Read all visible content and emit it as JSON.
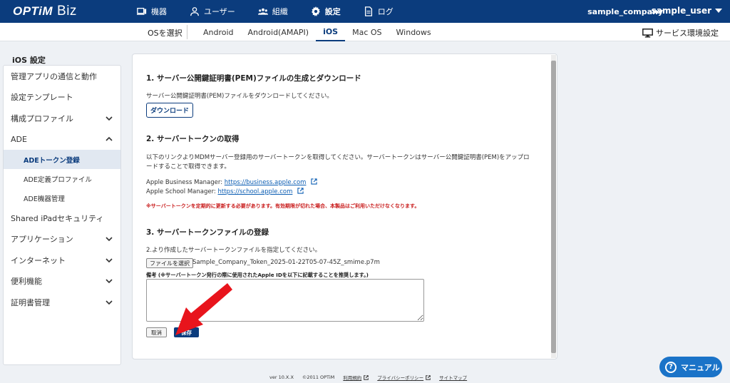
{
  "app": {
    "logo_main": "OPTiM",
    "logo_sub": "Biz",
    "company": "sample_company",
    "user": "sample_user"
  },
  "topnav": [
    {
      "label": "機器",
      "icon": "device-icon"
    },
    {
      "label": "ユーザー",
      "icon": "user-icon"
    },
    {
      "label": "組織",
      "icon": "group-icon"
    },
    {
      "label": "設定",
      "icon": "gear-icon",
      "active": true
    },
    {
      "label": "ログ",
      "icon": "document-icon"
    }
  ],
  "subnav": {
    "os_select": "OSを選択",
    "tabs": [
      "Android",
      "Android(AMAPI)",
      "iOS",
      "Mac OS",
      "Windows"
    ],
    "active_tab": "iOS",
    "env_settings": "サービス環境設定"
  },
  "sidebar": {
    "title": "iOS 設定",
    "items": [
      {
        "label": "管理アプリの通信と動作"
      },
      {
        "label": "設定テンプレート"
      },
      {
        "label": "構成プロファイル",
        "chevron": "down"
      },
      {
        "label": "ADE",
        "chevron": "up"
      },
      {
        "label": "ADEトークン登録",
        "sub": true,
        "active": true
      },
      {
        "label": "ADE定義プロファイル",
        "sub": true
      },
      {
        "label": "ADE機器管理",
        "sub": true
      },
      {
        "label": "Shared iPadセキュリティ"
      },
      {
        "label": "アプリケーション",
        "chevron": "down"
      },
      {
        "label": "インターネット",
        "chevron": "down"
      },
      {
        "label": "便利機能",
        "chevron": "down"
      },
      {
        "label": "証明書管理",
        "chevron": "down"
      }
    ]
  },
  "content": {
    "s1_title": "1. サーバー公開鍵証明書(PEM)ファイルの生成とダウンロード",
    "s1_text": "サーバー公開鍵証明書(PEM)ファイルをダウンロードしてください。",
    "download_label": "ダウンロード",
    "s2_title": "2. サーバートークンの取得",
    "s2_text1": "以下のリンクよりMDMサーバー登録用のサーバートークンを取得してください。サーバートークンはサーバー公開鍵証明書(PEM)をアップロ",
    "s2_text2": "ードすることで取得できます。",
    "abm_label": "Apple Business Manager: ",
    "abm_link": "https://business.apple.com",
    "asm_label": "Apple School Manager: ",
    "asm_link": "https://school.apple.com",
    "warning": "※サーバートークンを定期的に更新する必要があります。有効期限が切れた場合、本製品はご利用いただけなくなります。",
    "s3_title": "3. サーバートークンファイルの登録",
    "s3_text": "2.より作成したサーバートークンファイルを指定してください。",
    "file_button": "ファイルを選択",
    "file_name": "Sample_Company_Token_2025-01-22T05-07-45Z_smime.p7m",
    "memo_label": "備考 (※サーバートークン発行の際に使用されたApple IDを以下に記載することを推奨します。)",
    "memo_value": "",
    "cancel_label": "取消",
    "save_label": "保存"
  },
  "footer": {
    "version": "ver 10.X.X",
    "copyright": "©2011 OPTiM",
    "terms": "利用規約",
    "privacy": "プライバシーポリシー",
    "sitemap": "サイトマップ"
  },
  "manual_button": "マニュアル",
  "colors": {
    "brand": "#0b3c7d",
    "link": "#0b5db3",
    "warning": "#c81919",
    "arrow": "#e8141c",
    "manual": "#1a73c8"
  }
}
